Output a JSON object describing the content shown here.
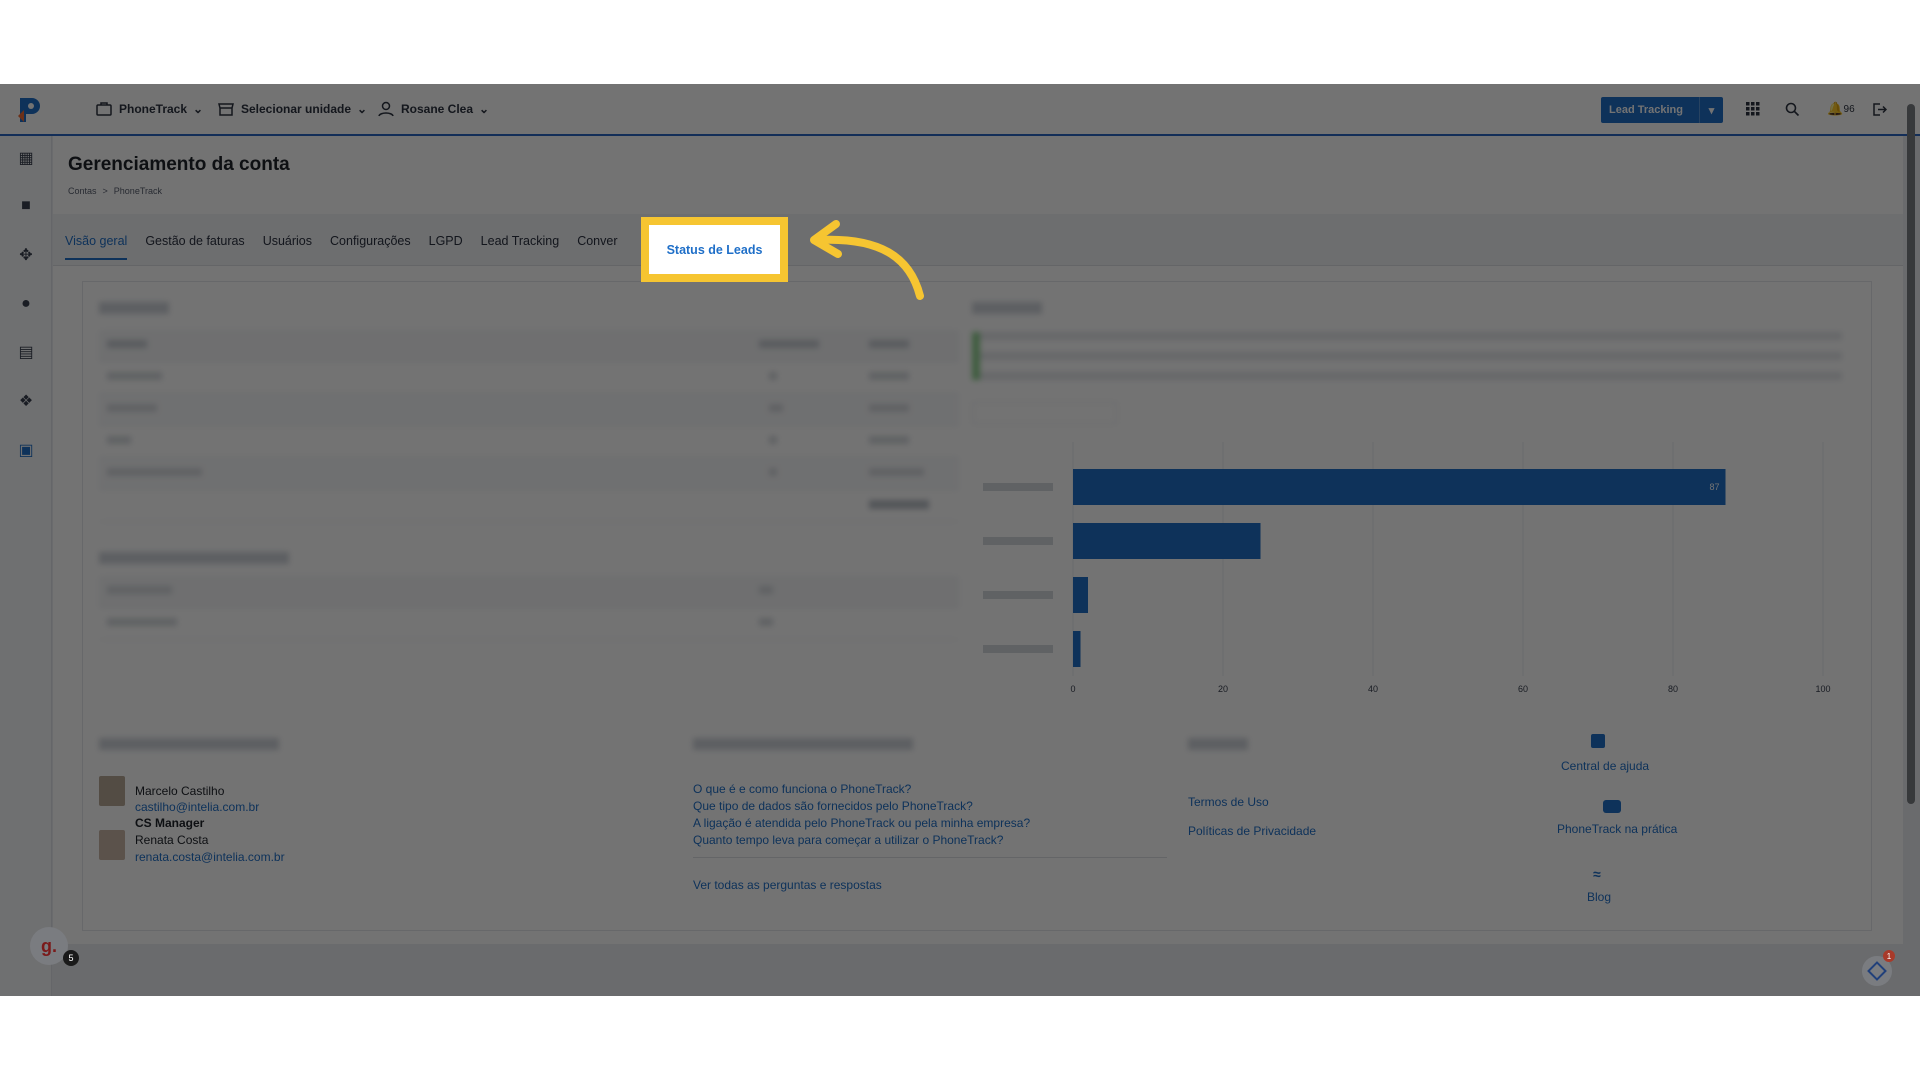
{
  "topbar": {
    "account_label": "PhoneTrack",
    "unit_label": "Selecionar unidade",
    "user_label": "Rosane Clea",
    "lead_tracking_button": "Lead Tracking",
    "notifications_count": "96"
  },
  "page": {
    "title": "Gerenciamento da conta",
    "breadcrumb": [
      "Contas",
      ">",
      "PhoneTrack"
    ]
  },
  "tabs": [
    "Visão geral",
    "Gestão de faturas",
    "Usuários",
    "Configurações",
    "LGPD",
    "Lead Tracking",
    "Conver"
  ],
  "highlighted_tab": "Status de Leads",
  "chart_data": {
    "type": "bar",
    "categories": [
      "",
      "",
      "",
      ""
    ],
    "values": [
      87,
      25,
      2,
      1
    ],
    "data_labels": [
      "87",
      "",
      "",
      ""
    ],
    "xticks": [
      "0",
      "20",
      "40",
      "60",
      "80",
      "100"
    ],
    "xlim": [
      0,
      100
    ],
    "orientation": "horizontal",
    "color": "#1f6fc8"
  },
  "contacts": {
    "person1_name": "Marcelo Castilho",
    "person1_email": "castilho@intelia.com.br",
    "person2_role": "CS Manager",
    "person2_name": "Renata Costa",
    "person2_email": "renata.costa@intelia.com.br"
  },
  "faq": {
    "q1": "O que é e como funciona o PhoneTrack?",
    "q2": "Que tipo de dados são fornecidos pelo PhoneTrack?",
    "q3": "A ligação é atendida pelo PhoneTrack ou pela minha empresa?",
    "q4": "Quanto tempo leva para começar a utilizar o PhoneTrack?",
    "see_all": "Ver todas as perguntas e respostas"
  },
  "policies": {
    "terms": "Termos de Uso",
    "privacy": "Políticas de Privacidade"
  },
  "help": {
    "central": "Central de ajuda",
    "practice": "PhoneTrack na prática",
    "blog": "Blog"
  },
  "widget_badge": "5",
  "chat_badge": "1"
}
